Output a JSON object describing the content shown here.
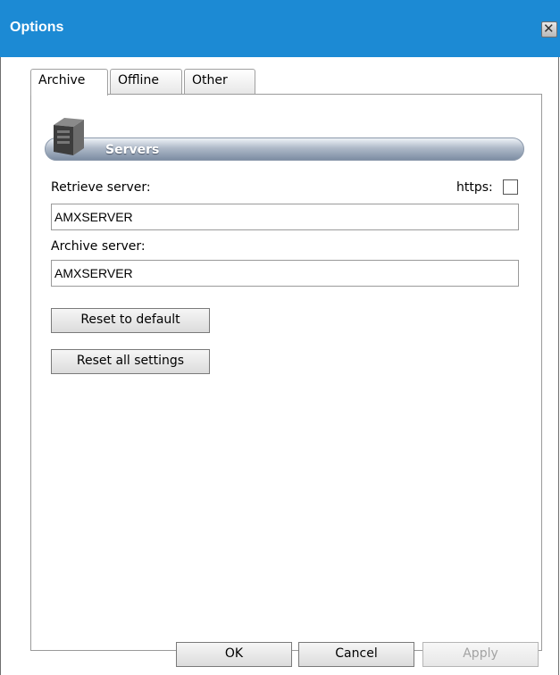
{
  "window": {
    "title": "Options",
    "close_symbol": "✕"
  },
  "tabs": [
    {
      "label": "Archive",
      "active": true
    },
    {
      "label": "Offline",
      "active": false
    },
    {
      "label": "Other",
      "active": false
    }
  ],
  "section": {
    "title": "Servers",
    "icon": "server-icon"
  },
  "retrieve": {
    "label": "Retrieve server:",
    "value": "AMXSERVER"
  },
  "https": {
    "label": "https:",
    "checked": false
  },
  "archive": {
    "label": "Archive server:",
    "value": "AMXSERVER"
  },
  "buttons": {
    "reset_default": "Reset to default",
    "reset_all": "Reset all settings",
    "ok": "OK",
    "cancel": "Cancel",
    "apply": "Apply"
  }
}
